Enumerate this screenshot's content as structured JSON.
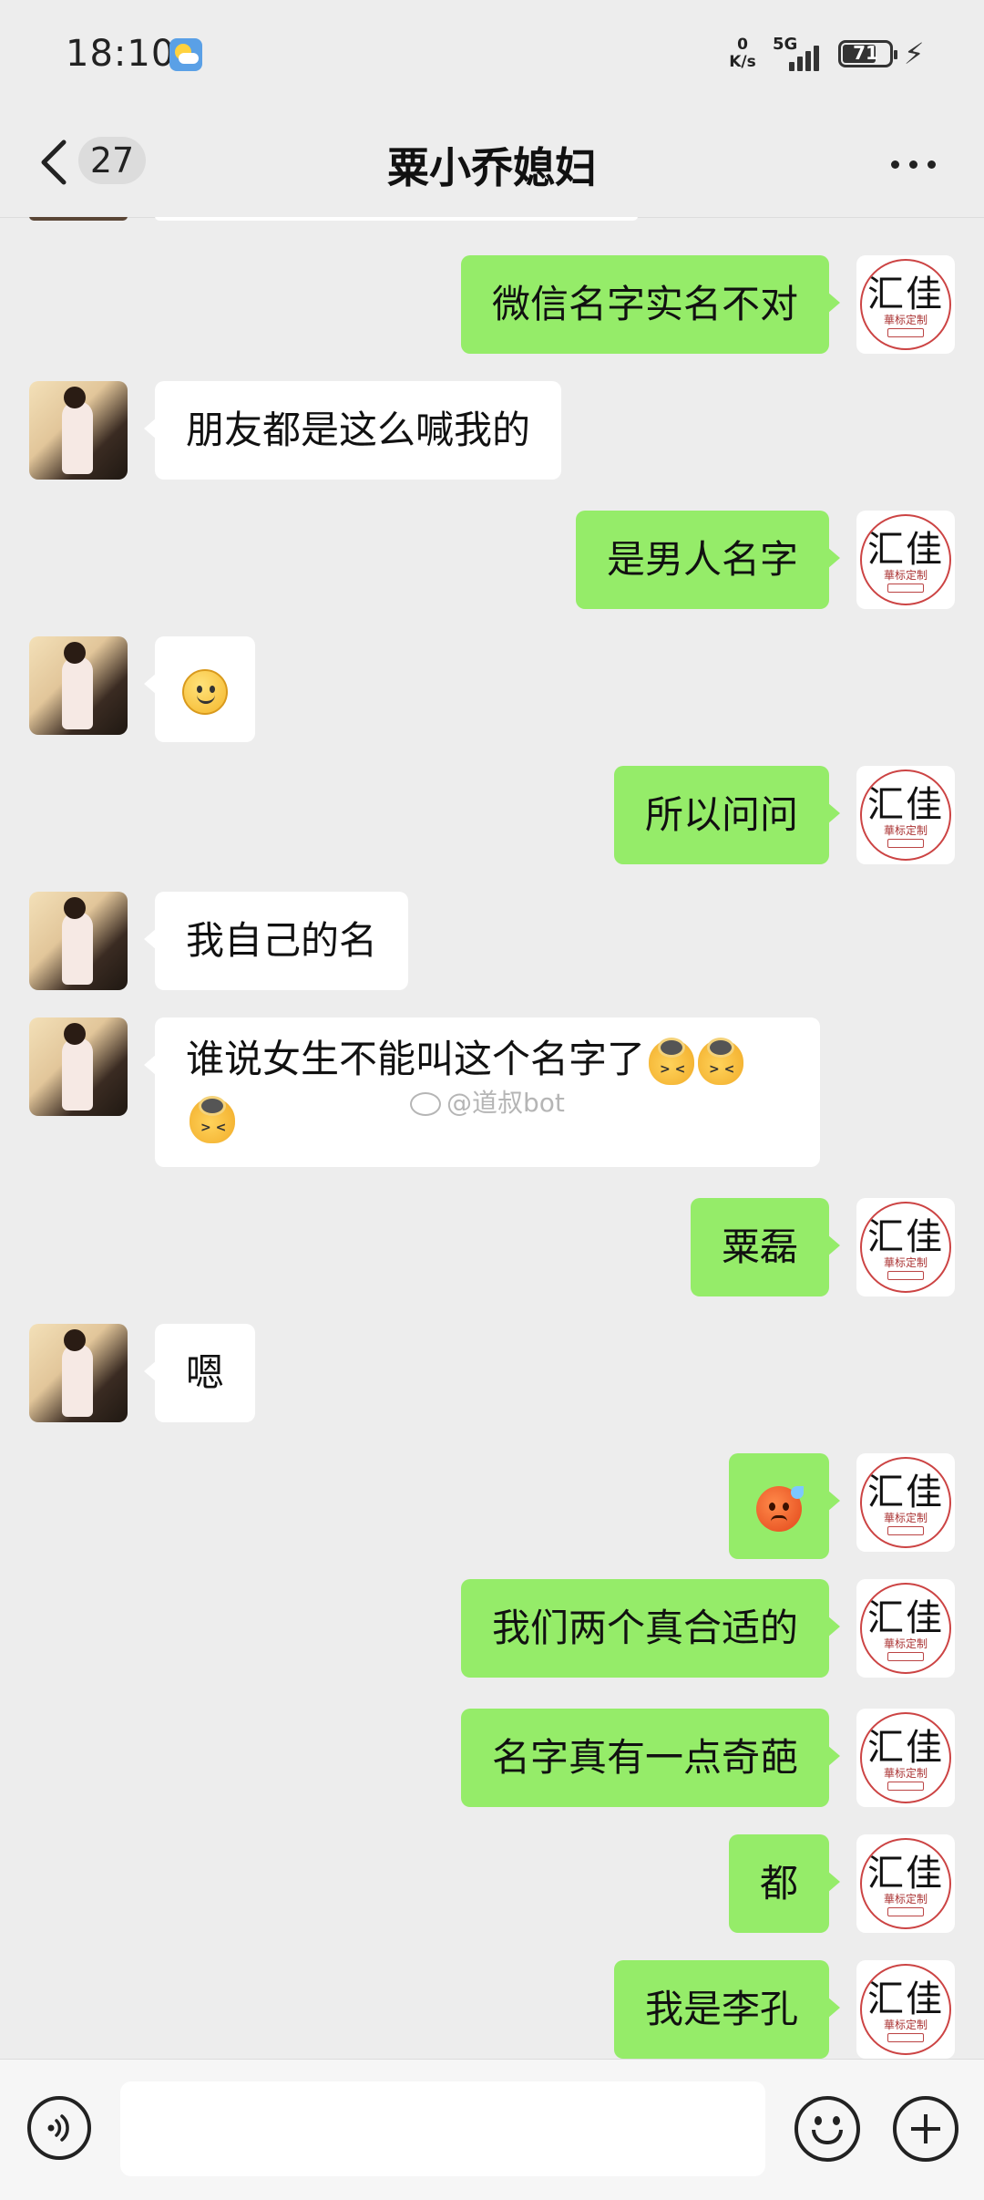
{
  "status_bar": {
    "time": "18:10",
    "net_speed_value": "0",
    "net_speed_unit": "K/s",
    "network_type": "5G",
    "battery_level": "71"
  },
  "header": {
    "back_icon": "chevron-left-icon",
    "unread_count": "27",
    "title": "粟小乔媳妇",
    "more_icon": "more-horizontal-icon"
  },
  "contact_avatar_text": {
    "main": "汇佳",
    "sub": "華标定制"
  },
  "messages": [
    {
      "side": "right",
      "text": "微信名字实名不对"
    },
    {
      "side": "left",
      "text": "朋友都是这么喊我的"
    },
    {
      "side": "right",
      "text": "是男人名字"
    },
    {
      "side": "left",
      "text": "",
      "emoji": "smile-emoji"
    },
    {
      "side": "right",
      "text": "所以问问"
    },
    {
      "side": "left",
      "text": "我自己的名"
    },
    {
      "side": "left",
      "text": "谁说女生不能叫这个名字了",
      "emoji": "facepalm-emoji",
      "emoji_count": 3
    },
    {
      "side": "right",
      "text": "粟磊"
    },
    {
      "side": "left",
      "text": "嗯"
    },
    {
      "side": "right",
      "text": "",
      "emoji": "angry-emoji"
    },
    {
      "side": "right",
      "text": "我们两个真合适的"
    },
    {
      "side": "right",
      "text": "名字真有一点奇葩"
    },
    {
      "side": "right",
      "text": "都"
    },
    {
      "side": "right",
      "text": "我是李孔"
    }
  ],
  "watermark": "@道叔bot",
  "input_bar": {
    "voice_icon": "voice-icon",
    "emoji_icon": "emoji-icon",
    "plus_icon": "plus-icon"
  }
}
